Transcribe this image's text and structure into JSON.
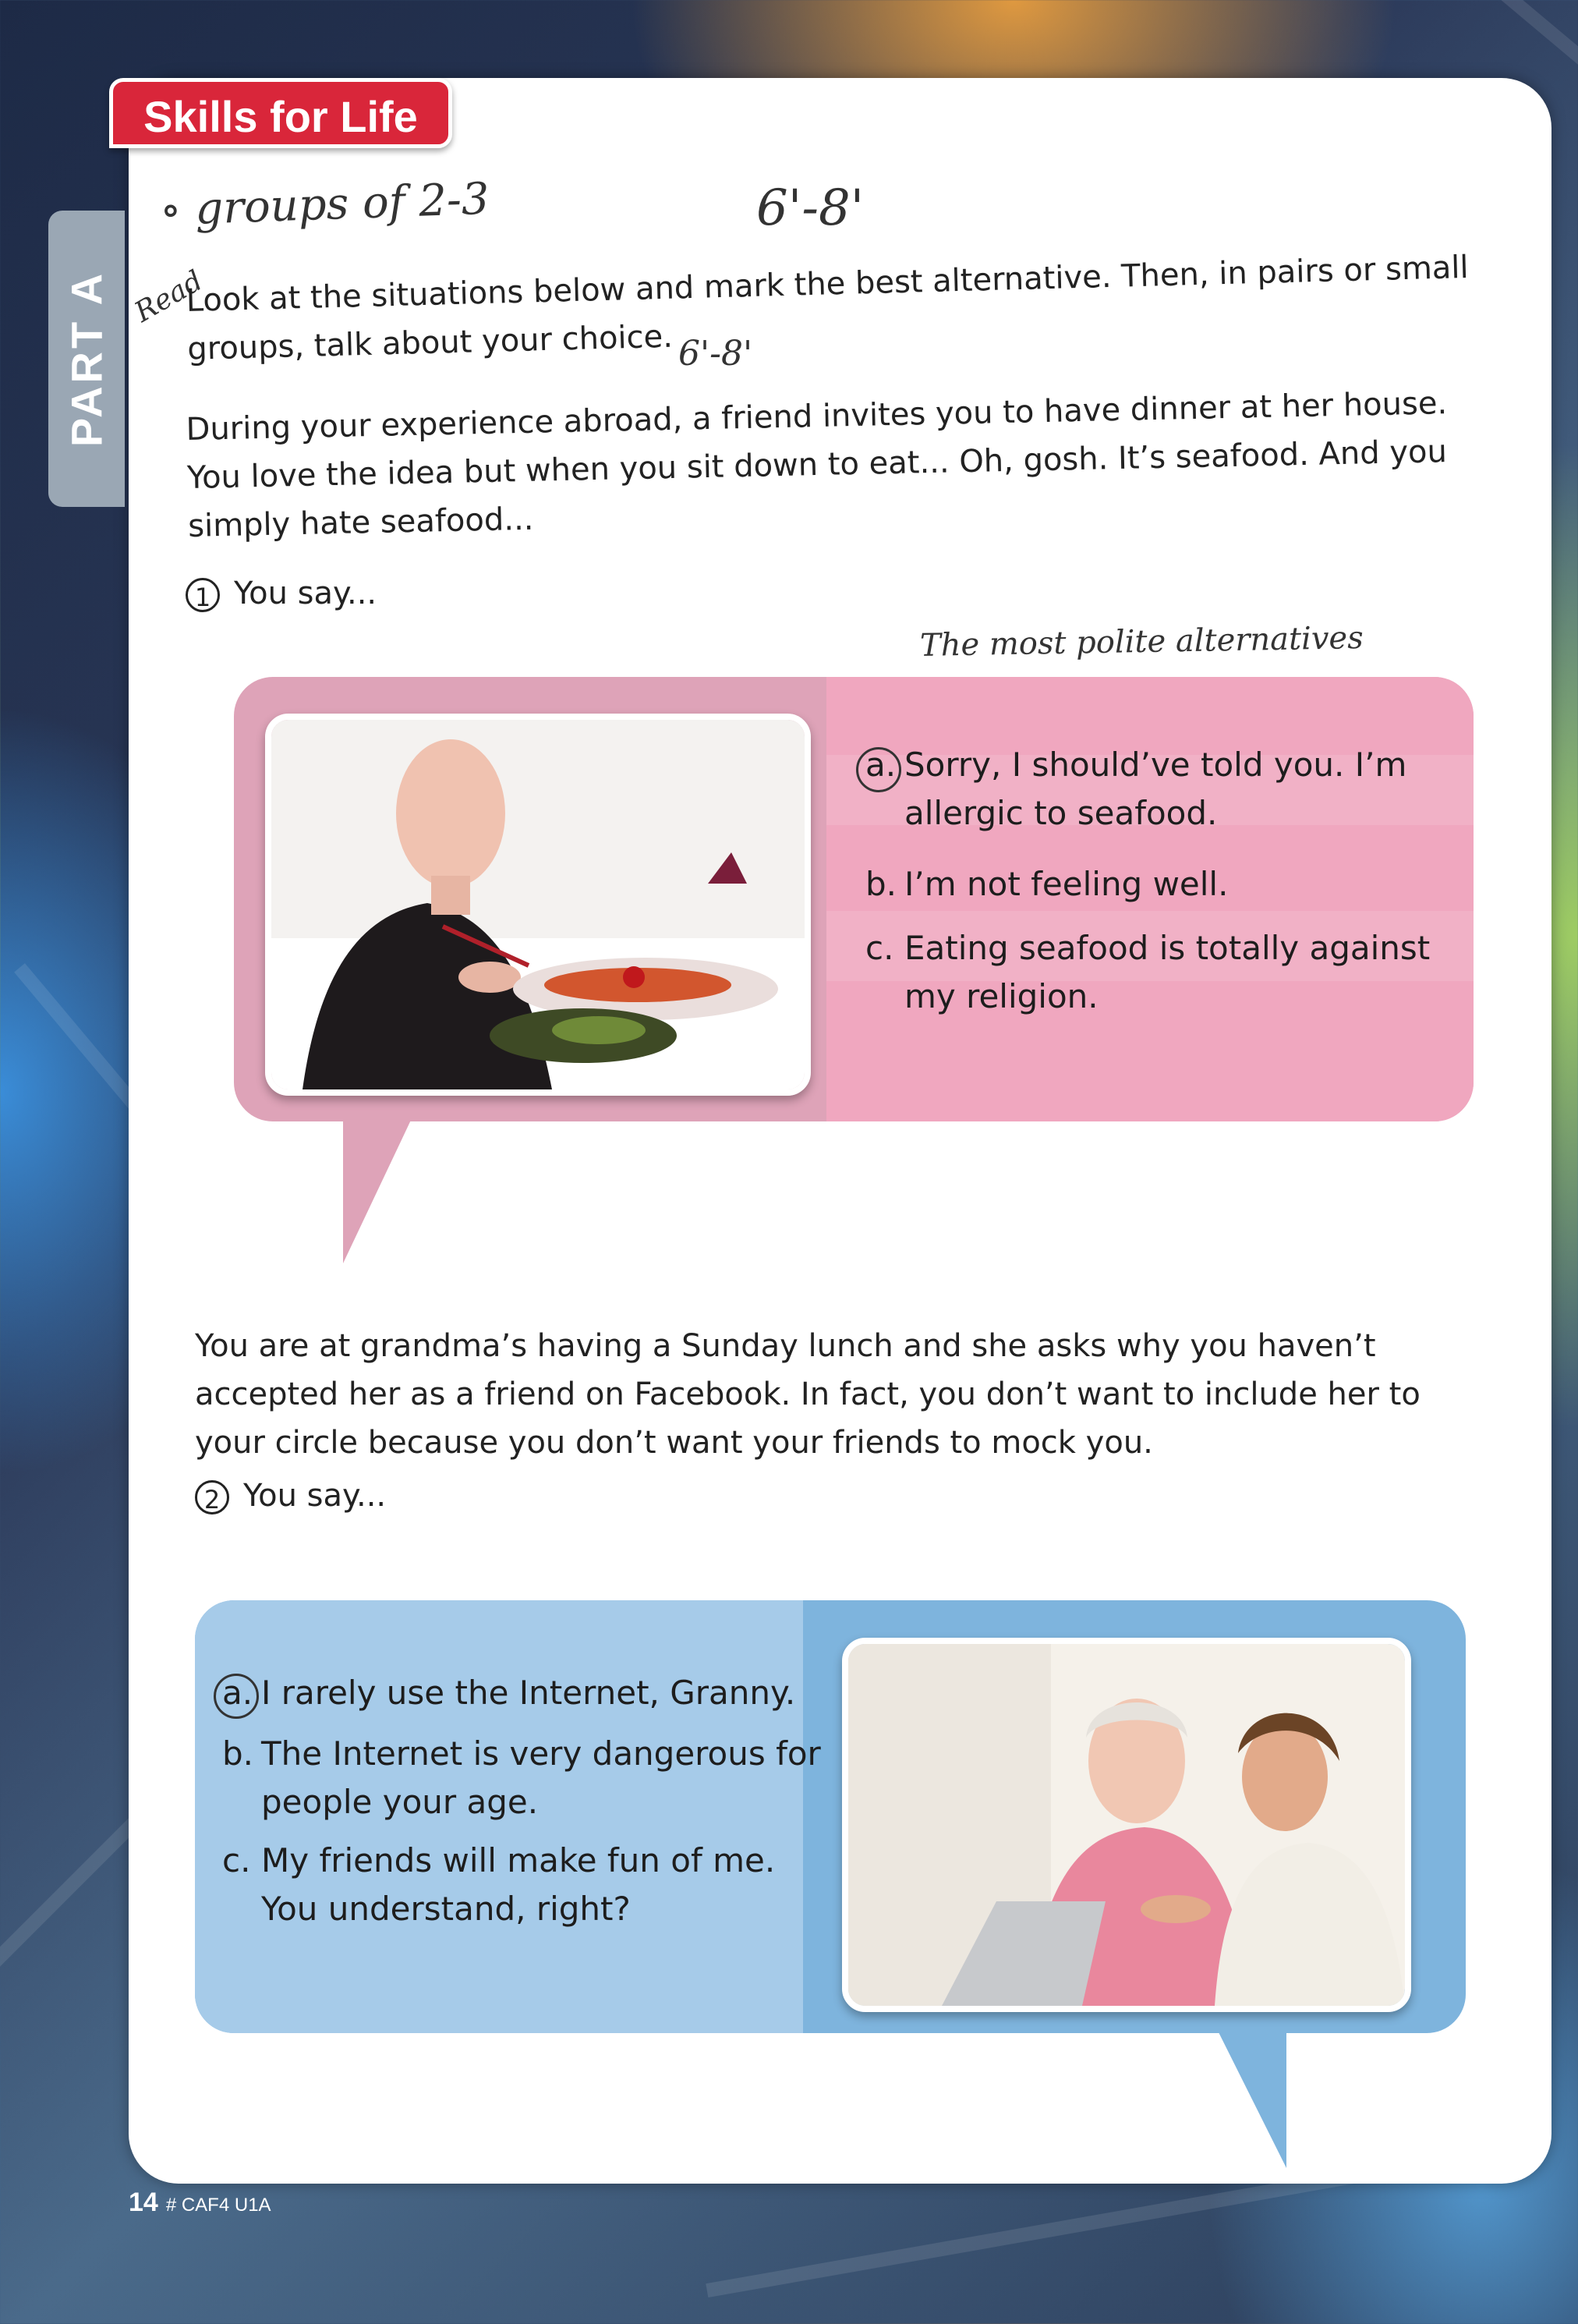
{
  "header": {
    "tag": "Skills for Life",
    "section_tab": "PART A"
  },
  "handwriting": {
    "groups_note": "∘ groups of 2-3",
    "time_note_1": "6'-8'",
    "read_note": "Read",
    "time_note_2": "6'-8'",
    "polite_note": "The most polite alternatives"
  },
  "instructions": "Look at the situations below and mark the best alternative. Then, in pairs or small groups, talk about your choice.",
  "situation1": {
    "text": "During your experience abroad, a friend invites you to have dinner at her house. You love the idea but when you sit down to eat... Oh, gosh. It’s seafood. And you simply hate seafood...",
    "number": "1",
    "prompt": "You say...",
    "options": [
      {
        "letter": "a.",
        "line1": "Sorry, I should’ve told you. I’m",
        "line2": "allergic to seafood."
      },
      {
        "letter": "b.",
        "line1": "I’m not feeling well.",
        "line2": ""
      },
      {
        "letter": "c.",
        "line1": "Eating seafood is totally against",
        "line2": "my religion."
      }
    ],
    "colors": {
      "bubble": "#dea3b8",
      "panel": "#f0a7bf"
    }
  },
  "situation2": {
    "text": "You are at grandma’s having a Sunday lunch and she asks why you haven’t accepted her as a friend on Facebook. In fact, you don’t want to include her to your circle because you don’t want your friends to mock you.",
    "number": "2",
    "prompt": "You say...",
    "options": [
      {
        "letter": "a.",
        "line1": "I rarely use the Internet, Granny.",
        "line2": ""
      },
      {
        "letter": "b.",
        "line1": "The Internet is very dangerous for",
        "line2": "people your age."
      },
      {
        "letter": "c.",
        "line1": "My friends will make fun of me.",
        "line2": "You understand, right?"
      }
    ],
    "colors": {
      "bubble": "#7eb4dd",
      "panel": "#a6cbe9"
    }
  },
  "footer": {
    "page_number": "14",
    "code": "# CAF4 U1A"
  }
}
